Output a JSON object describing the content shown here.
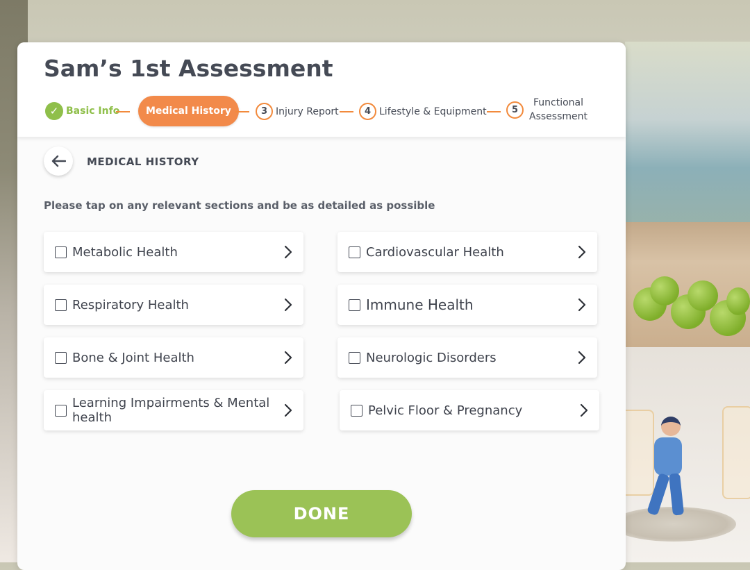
{
  "assessment": {
    "title": "Sam’s  1st Assessment"
  },
  "steps": [
    {
      "label": "Basic Info",
      "state": "completed"
    },
    {
      "label": "Medical History",
      "state": "active"
    },
    {
      "number": "3",
      "label": "Injury Report",
      "state": "pending"
    },
    {
      "number": "4",
      "label": "Lifestyle & Equipment",
      "state": "pending"
    },
    {
      "number": "5",
      "label_line1": "Functional",
      "label_line2": "Assessment",
      "state": "pending"
    }
  ],
  "section": {
    "title": "MEDICAL HISTORY",
    "back_icon": "arrow-left-icon"
  },
  "instructions": "Please tap on any relevant sections and be as detailed as possible",
  "options": [
    {
      "label": "Metabolic Health",
      "checked": false
    },
    {
      "label": "Cardiovascular Health",
      "checked": false
    },
    {
      "label": "Respiratory Health",
      "checked": false
    },
    {
      "label": "Immune Health",
      "checked": false
    },
    {
      "label": "Bone & Joint Health",
      "checked": false
    },
    {
      "label": "Neurologic Disorders",
      "checked": false
    },
    {
      "label": "Learning Impairments & Mental health",
      "checked": false
    },
    {
      "label": "Pelvic Floor & Pregnancy",
      "checked": false
    }
  ],
  "done_label": "DONE",
  "colors": {
    "accent_orange": "#f28a4a",
    "accent_green": "#9bc256",
    "text_dark": "#454a55"
  }
}
